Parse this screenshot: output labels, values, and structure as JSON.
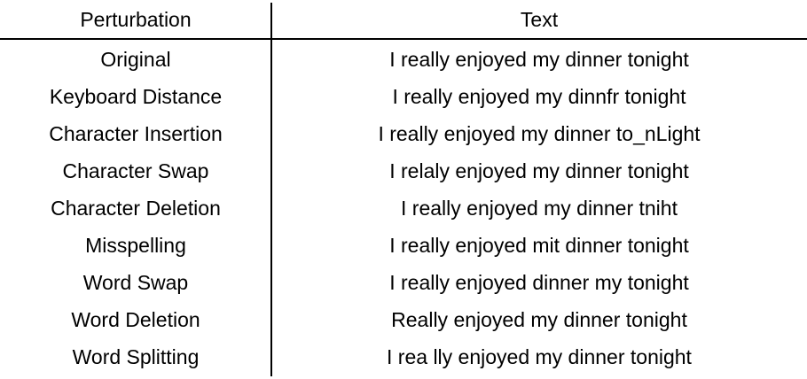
{
  "table": {
    "headers": {
      "perturbation": "Perturbation",
      "text": "Text"
    },
    "rows": [
      {
        "perturbation": "Original",
        "text": "I really enjoyed my dinner tonight"
      },
      {
        "perturbation": "Keyboard Distance",
        "text": "I really enjoyed my dinnfr tonight"
      },
      {
        "perturbation": "Character Insertion",
        "text": "I really enjoyed my dinner to_nLight"
      },
      {
        "perturbation": "Character Swap",
        "text": "I relaly enjoyed my dinner tonight"
      },
      {
        "perturbation": "Character Deletion",
        "text": "I really enjoyed my dinner tniht"
      },
      {
        "perturbation": "Misspelling",
        "text": "I really enjoyed mit dinner tonight"
      },
      {
        "perturbation": "Word Swap",
        "text": "I really enjoyed dinner my tonight"
      },
      {
        "perturbation": "Word Deletion",
        "text": "Really enjoyed my dinner tonight"
      },
      {
        "perturbation": "Word Splitting",
        "text": "I rea lly enjoyed my dinner tonight"
      }
    ]
  }
}
